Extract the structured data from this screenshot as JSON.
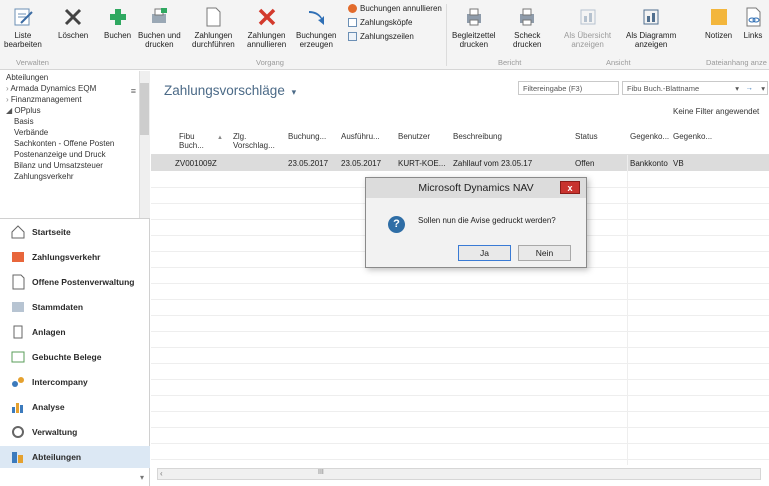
{
  "ribbon": {
    "buttons": [
      {
        "label": "Liste\nbearbeiten",
        "icon": "edit-list-icon"
      },
      {
        "label": "Löschen",
        "icon": "delete-x-icon"
      },
      {
        "label": "Buchen",
        "icon": "post-plus-icon"
      },
      {
        "label": "Buchen und\ndrucken",
        "icon": "post-print-icon"
      },
      {
        "label": "Zahlungen\ndurchführen",
        "icon": "document-icon"
      },
      {
        "label": "Zahlungen\nannullieren",
        "icon": "cancel-x-icon"
      },
      {
        "label": "Buchungen\nerzeugen",
        "icon": "arrow-return-icon"
      },
      {
        "label": "Begleitzettel\ndrucken",
        "icon": "printer-icon"
      },
      {
        "label": "Scheck\ndrucken",
        "icon": "printer-icon"
      },
      {
        "label": "Als Übersicht\nanzeigen",
        "icon": "overview-icon"
      },
      {
        "label": "Als Diagramm\nanzeigen",
        "icon": "chart-icon"
      },
      {
        "label": "Notizen",
        "icon": "note-icon"
      },
      {
        "label": "Links",
        "icon": "link-icon"
      }
    ],
    "small_buttons": [
      {
        "label": "Buchungen annullieren",
        "icon": "cancel-small-icon"
      },
      {
        "label": "Zahlungsköpfe",
        "icon": "header-small-icon"
      },
      {
        "label": "Zahlungszeilen",
        "icon": "lines-small-icon"
      }
    ],
    "groups": [
      "Verwalten",
      "Vorgang",
      "Bericht",
      "Ansicht",
      "Dateianhang anze"
    ]
  },
  "nav": {
    "tree_items": [
      "Abteilungen",
      "Armada Dynamics EQM",
      "Finanzmanagement",
      "OPplus",
      "Basis",
      "Verbände",
      "Sachkonten - Offene Posten",
      "Postenanzeige und Druck",
      "Bilanz und Umsatzsteuer",
      "Zahlungsverkehr"
    ],
    "sections": [
      {
        "label": "Startseite",
        "icon": "home-icon"
      },
      {
        "label": "Zahlungsverkehr",
        "icon": "payment-icon"
      },
      {
        "label": "Offene Postenverwaltung",
        "icon": "open-items-icon"
      },
      {
        "label": "Stammdaten",
        "icon": "master-data-icon"
      },
      {
        "label": "Anlagen",
        "icon": "assets-icon"
      },
      {
        "label": "Gebuchte Belege",
        "icon": "posted-docs-icon"
      },
      {
        "label": "Intercompany",
        "icon": "intercompany-icon"
      },
      {
        "label": "Analyse",
        "icon": "analysis-icon"
      },
      {
        "label": "Verwaltung",
        "icon": "admin-icon"
      },
      {
        "label": "Abteilungen",
        "icon": "departments-icon"
      }
    ]
  },
  "main": {
    "title": "Zahlungsvorschläge",
    "filter_placeholder": "Filtereingabe (F3)",
    "filter_field": "Fibu Buch.-Blattname",
    "no_filter": "Keine Filter angewendet",
    "columns": [
      "Fibu\nBuch...",
      "Zlg.\nVorschlag...",
      "Buchung...",
      "Ausführu...",
      "Benutzer",
      "Beschreibung",
      "Status",
      "Gegenko...",
      "Gegenko..."
    ],
    "row": {
      "fibu": "ZV001009Z",
      "vorschlag": "",
      "buchung": "23.05.2017",
      "ausfuehrung": "23.05.2017",
      "benutzer": "KURT-KOE...",
      "beschreibung": "Zahllauf vom 23.05.17",
      "status": "Offen",
      "gegenko1": "Bankkonto",
      "gegenko2": "VB"
    },
    "scroll_marker": "III"
  },
  "dialog": {
    "title": "Microsoft Dynamics NAV",
    "message": "Sollen nun die Avise gedruckt werden?",
    "yes": "Ja",
    "no": "Nein",
    "close": "x"
  }
}
